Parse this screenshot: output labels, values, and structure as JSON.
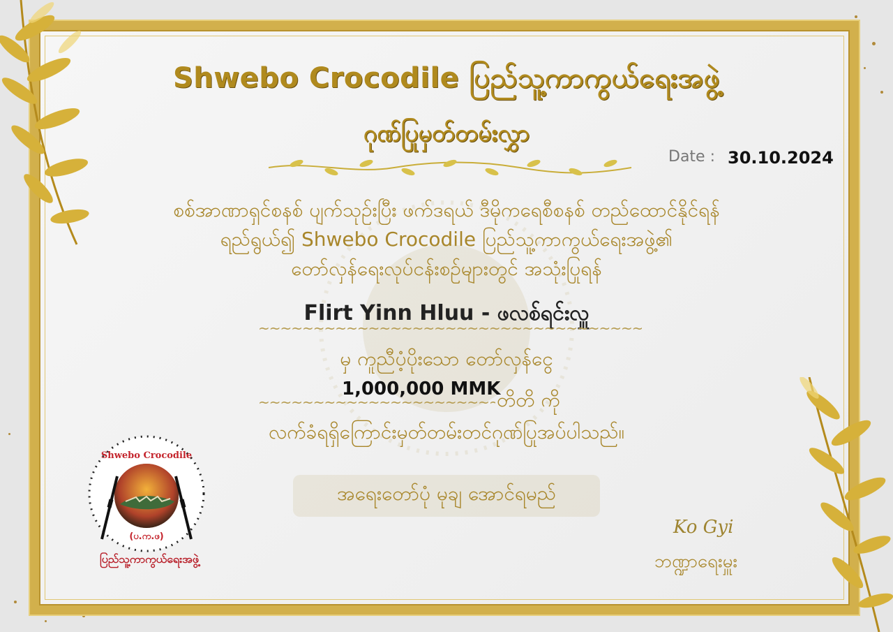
{
  "certificate": {
    "title": "Shwebo Crocodile ပြည်သူ့ကာကွယ်ရေးအဖွဲ့",
    "subtitle": "ဂုဏ်ပြုမှတ်တမ်းလွှာ",
    "date_label": "Date :",
    "date_value": "30.10.2024",
    "body_lines": [
      "စစ်အာဏာရှင်စနစ် ပျက်သုဉ်းပြီး ဖက်ဒရယ် ဒီမိုကရေစီစနစ် တည်ထောင်နိုင်ရန်",
      "ရည်ရွယ်၍ Shwebo Crocodile ပြည်သူ့ကာကွယ်ရေးအဖွဲ့၏",
      "တော်လှန်ရေးလုပ်ငန်းစဉ်များတွင် အသုံးပြုရန်"
    ],
    "donor_name": "Flirt Yinn Hluu - ဖလစ်ရင်းလှူ",
    "donation_line": "မှ ကူညီပံ့ပိုးသော တော်လှန်ငွေ",
    "amount": "1,000,000 MMK",
    "amount_suffix": "တိတိ ကို",
    "closing_line": "လက်ခံရရှိကြောင်းမှတ်တမ်းတင်ဂုဏ်ပြုအပ်ပါသည်။",
    "motto": "အရေးတော်ပုံ မုချ အောင်ရမည်",
    "signature": "Ko Gyi",
    "signer_title": "ဘဏ္ဍာရေးမှူး",
    "squiggle": "~~~~~~~~~~~~~~~~~~~~~~~~~~~~~~~~~~~~~~~~~~~~~~~~"
  },
  "logo": {
    "top_text": "Shwebo Crocodile",
    "badge_text": "(ပ.က.ဖ)",
    "caption": "ပြည်သူ့ကာကွယ်ရေးအဖွဲ့"
  },
  "colors": {
    "gold": "#b08a1e",
    "frame_gold": "#d2b04c",
    "background": "#f2f2f2"
  }
}
